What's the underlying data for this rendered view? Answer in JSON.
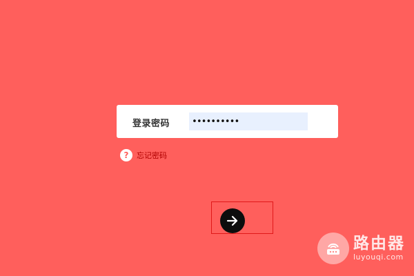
{
  "login": {
    "password_label": "登录密码",
    "password_value": "••••••••••"
  },
  "forgot": {
    "icon_glyph": "?",
    "label": "忘记密码"
  },
  "submit": {
    "icon": "arrow-right-icon"
  },
  "watermark": {
    "title": "路由器",
    "url": "luyouqi.com"
  },
  "colors": {
    "background": "#ff5f5c",
    "input_fill": "#e8f0fe",
    "highlight_border": "#e01818"
  }
}
